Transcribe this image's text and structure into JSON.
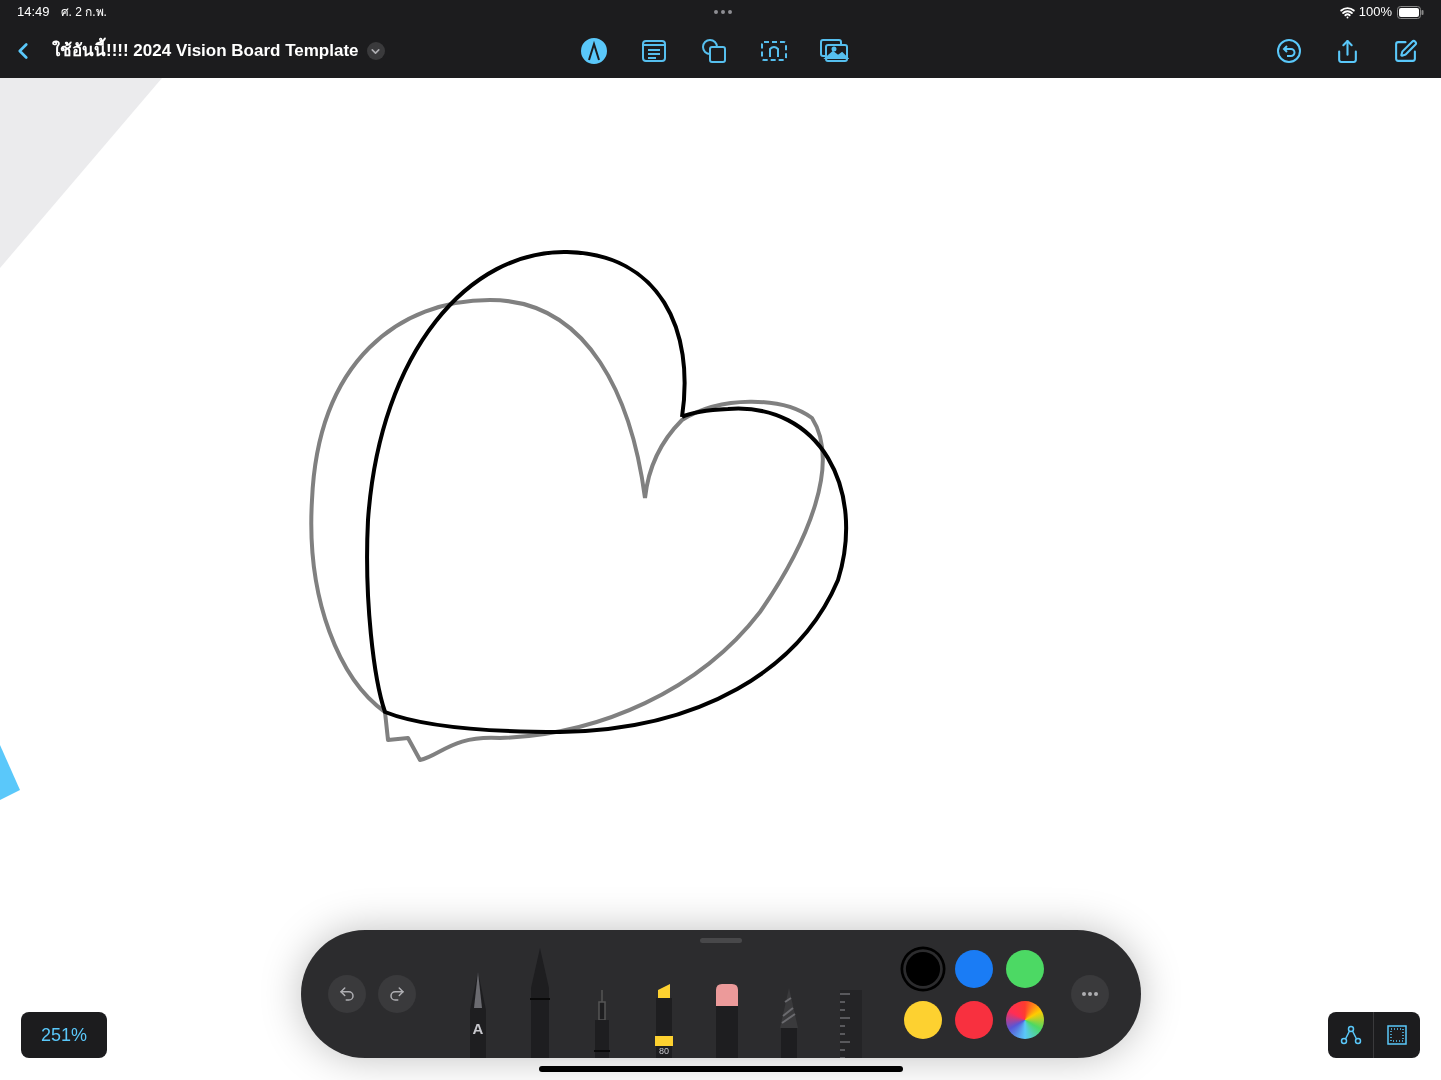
{
  "status_bar": {
    "time": "14:49",
    "date": "ศ. 2 ก.พ.",
    "battery": "100%"
  },
  "nav_bar": {
    "title": "ใช้อันนี้!!!! 2024 Vision Board Template",
    "tools": [
      {
        "kind": "markup",
        "selected": true
      },
      {
        "kind": "text",
        "selected": false
      },
      {
        "kind": "shapes",
        "selected": false
      },
      {
        "kind": "textbox",
        "selected": false
      },
      {
        "kind": "media",
        "selected": false
      }
    ]
  },
  "zoom": "251%",
  "drawing_toolbar": {
    "pens": [
      {
        "kind": "pen",
        "label": "A",
        "selected": false
      },
      {
        "kind": "monoline",
        "selected": true
      },
      {
        "kind": "fineliner",
        "selected": false
      },
      {
        "kind": "marker",
        "label": "80",
        "selected": false
      },
      {
        "kind": "eraser",
        "selected": false
      },
      {
        "kind": "pencil",
        "selected": false
      },
      {
        "kind": "ruler",
        "selected": false
      }
    ],
    "colors": [
      {
        "kind": "solid",
        "color": "#000000",
        "selected": true
      },
      {
        "kind": "solid",
        "color": "#1a7cf5",
        "selected": false
      },
      {
        "kind": "solid",
        "color": "#4cd964",
        "selected": false
      },
      {
        "kind": "solid",
        "color": "#fdd130",
        "selected": false
      },
      {
        "kind": "solid",
        "color": "#f8303f",
        "selected": false
      },
      {
        "kind": "spectrum",
        "selected": false
      }
    ]
  }
}
